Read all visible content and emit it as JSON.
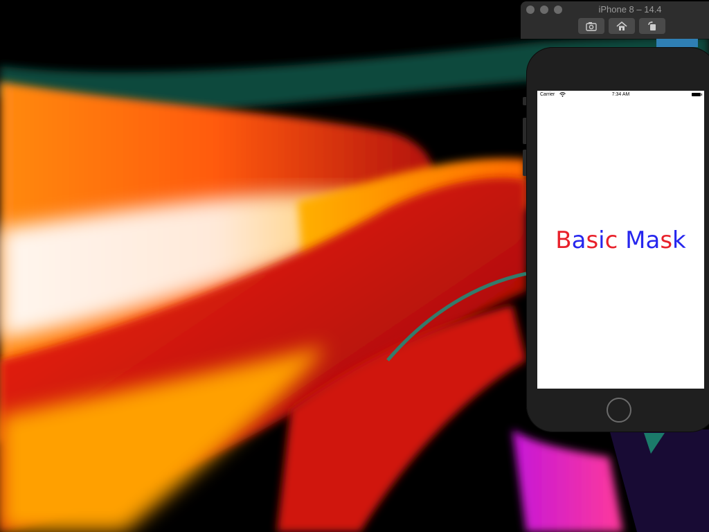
{
  "simulator": {
    "window_title": "iPhone 8 – 14.4",
    "toolbar": {
      "screenshot_icon": "camera-icon",
      "home_icon": "home-icon",
      "rotate_icon": "rotate-icon"
    }
  },
  "device": {
    "status_bar": {
      "carrier": "Carrier",
      "time": "7:34 AM"
    },
    "app": {
      "title_segments": [
        {
          "text": "B",
          "color": "#e8202a"
        },
        {
          "text": "a",
          "color": "#2626ee"
        },
        {
          "text": "s",
          "color": "#e8202a"
        },
        {
          "text": "i",
          "color": "#2626ee"
        },
        {
          "text": "c",
          "color": "#e8202a"
        },
        {
          "text": " ",
          "color": "#2626ee"
        },
        {
          "text": "M",
          "color": "#2626ee"
        },
        {
          "text": "a",
          "color": "#2626ee"
        },
        {
          "text": "s",
          "color": "#e8202a"
        },
        {
          "text": "k",
          "color": "#2626ee"
        }
      ]
    }
  },
  "colors": {
    "red": "#e8202a",
    "blue": "#2626ee",
    "simulator_chrome": "#2d2d2d",
    "phone_body": "#1f1f1f"
  }
}
